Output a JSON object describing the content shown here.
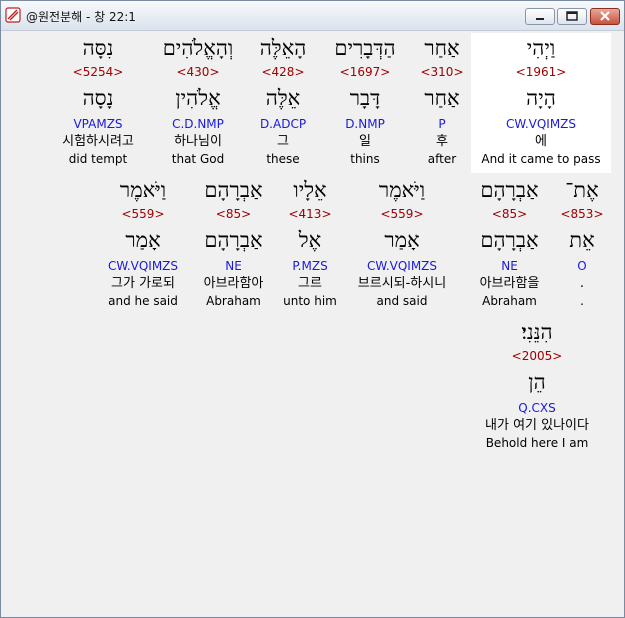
{
  "window": {
    "title": "@원전분해 - 창 22:1"
  },
  "words": [
    {
      "hebrew": "וַיְהִי",
      "strong": "<1961>",
      "lemma": "הָיָה",
      "parse": "CW.VQIMZS",
      "korean": "에",
      "english": "And it came to pass",
      "selected": true
    },
    {
      "hebrew": "אַחַר",
      "strong": "<310>",
      "lemma": "אַחַר",
      "parse": "P",
      "korean": "후",
      "english": "after"
    },
    {
      "hebrew": "הַדְּבָרִים",
      "strong": "<1697>",
      "lemma": "דָּבָר",
      "parse": "D.NMP",
      "korean": "일",
      "english": "thins"
    },
    {
      "hebrew": "הָאֵלֶּה",
      "strong": "<428>",
      "lemma": "אֵלֶּה",
      "parse": "D.ADCP",
      "korean": "그",
      "english": "these"
    },
    {
      "hebrew": "וְהָאֱלֹהִים",
      "strong": "<430>",
      "lemma": "אֱלֹהִין",
      "parse": "C.D.NMP",
      "korean": "하나님이",
      "english": "that God"
    },
    {
      "hebrew": "נִסָּה",
      "strong": "<5254>",
      "lemma": "נָסָה",
      "parse": "VPAMZS",
      "korean": "시험하시려고",
      "english": "did tempt"
    },
    {
      "hebrew": "אֶת־",
      "strong": "<853>",
      "lemma": "אֵת",
      "parse": "O",
      "korean": ".",
      "english": "."
    },
    {
      "hebrew": "אַבְרָהָם",
      "strong": "<85>",
      "lemma": "אַבְרָהָם",
      "parse": "NE",
      "korean": "아브라함을",
      "english": "Abraham"
    },
    {
      "hebrew": "וַיֹּאמֶר",
      "strong": "<559>",
      "lemma": "אָמַר",
      "parse": "CW.VQIMZS",
      "korean": "브르시되-하시니",
      "english": "and said"
    },
    {
      "hebrew": "אֵלָיו",
      "strong": "<413>",
      "lemma": "אֶל",
      "parse": "P.MZS",
      "korean": "그르",
      "english": "unto him"
    },
    {
      "hebrew": "אַבְרָהָם",
      "strong": "<85>",
      "lemma": "אַבְרָהָם",
      "parse": "NE",
      "korean": "아브라함아",
      "english": "Abraham"
    },
    {
      "hebrew": "וַיֹּאמֶר",
      "strong": "<559>",
      "lemma": "אָמַר",
      "parse": "CW.VQIMZS",
      "korean": "그가 가로되",
      "english": "and he said"
    },
    {
      "hebrew": "הִנֵּנִי׃",
      "strong": "<2005>",
      "lemma": "הֵן",
      "parse": "Q.CXS",
      "korean": "내가 여기 있나이다",
      "english": "Behold here I am"
    }
  ]
}
